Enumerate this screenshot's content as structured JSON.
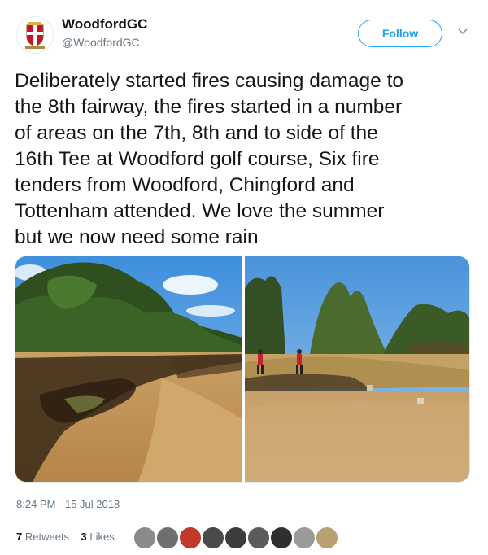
{
  "account": {
    "name": "WoodfordGC",
    "handle": "@WoodfordGC"
  },
  "follow_label": "Follow",
  "tweet_lines": [
    "Deliberately started fires causing damage to",
    "the 8th fairway, the fires started in a number",
    "of areas on the 7th, 8th and to side of the",
    "16th Tee at Woodford golf course, Six fire",
    "tenders from Woodford, Chingford and",
    "Tottenham attended. We love the summer",
    "but we now need some rain"
  ],
  "timestamp": "8:24 PM - 15 Jul 2018",
  "stats": {
    "retweets_count": "7",
    "retweets_label": "Retweets",
    "likes_count": "3",
    "likes_label": "Likes"
  },
  "colors": {
    "accent": "#1da1f2",
    "text": "#14171a",
    "secondary": "#657786"
  },
  "icons": {
    "caret": "chevron-down-icon",
    "avatar": "club-crest-icon"
  }
}
